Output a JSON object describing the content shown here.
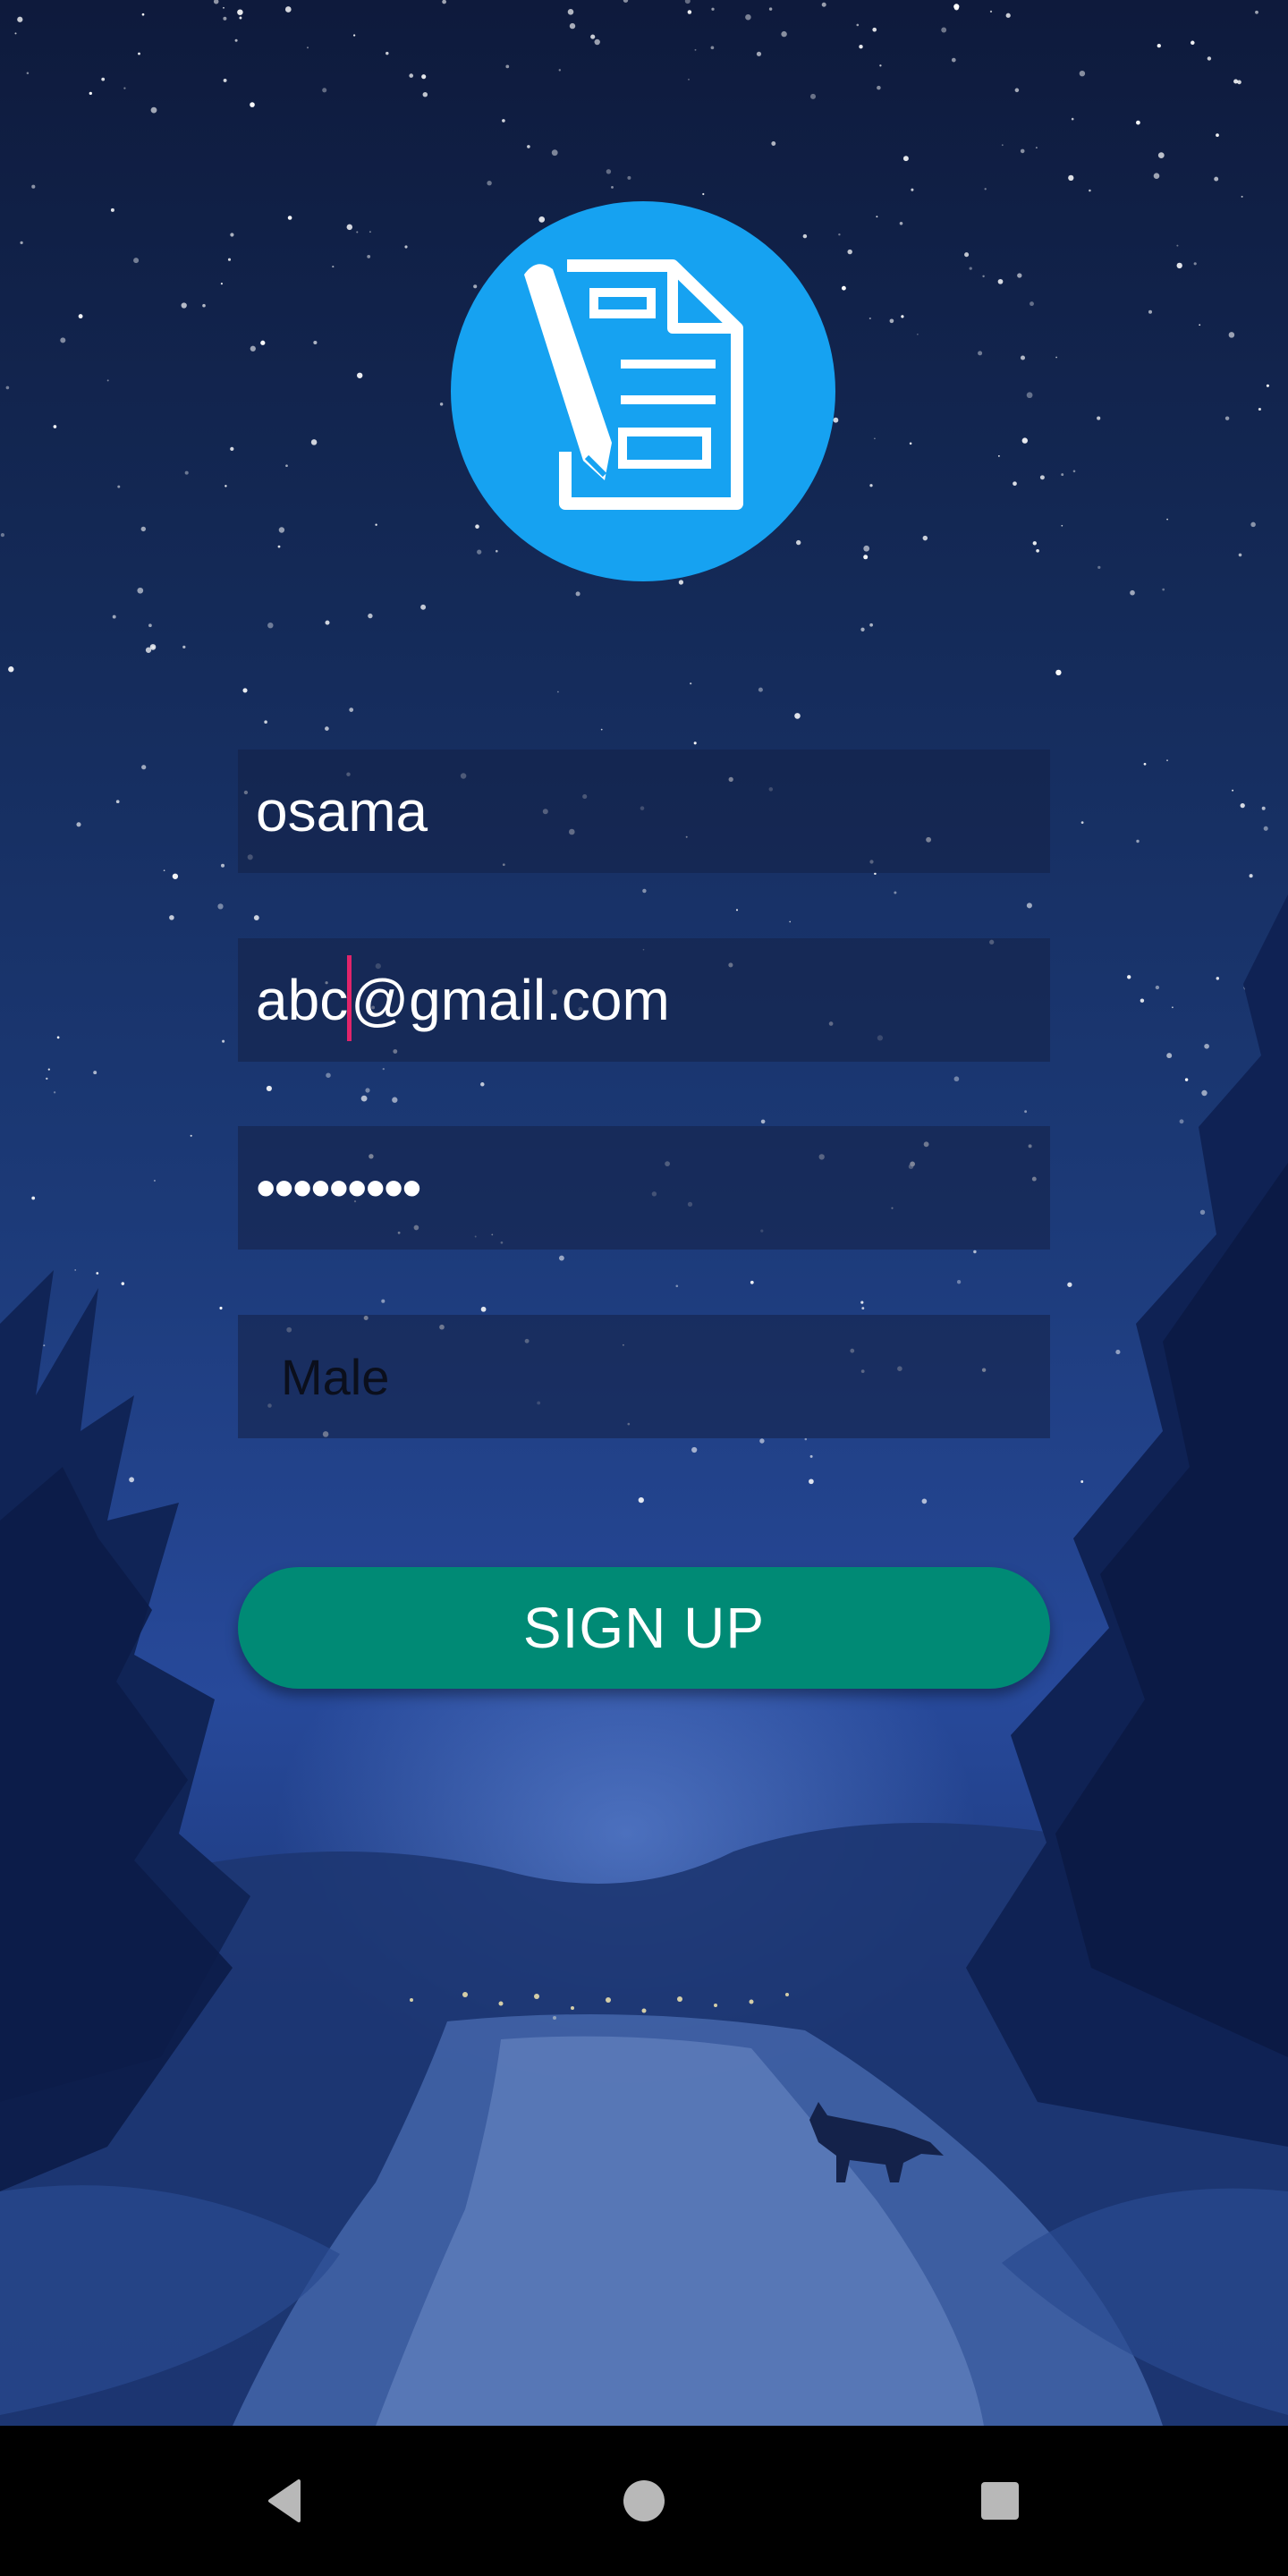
{
  "form": {
    "name_value": "osama",
    "email_before_caret": "abc",
    "email_after_caret": "@gmail.com",
    "password_masked": "•••••••••",
    "gender_selected": "Male"
  },
  "signup_button": {
    "label": "SIGN UP"
  },
  "colors": {
    "logo_bg": "#16a2f1",
    "button_bg": "#008a75",
    "caret": "#e0246a",
    "navbar_bg": "#000000"
  },
  "icons": {
    "logo": "document-edit-icon",
    "nav_back": "back-triangle-icon",
    "nav_home": "home-circle-icon",
    "nav_recents": "recents-square-icon"
  }
}
